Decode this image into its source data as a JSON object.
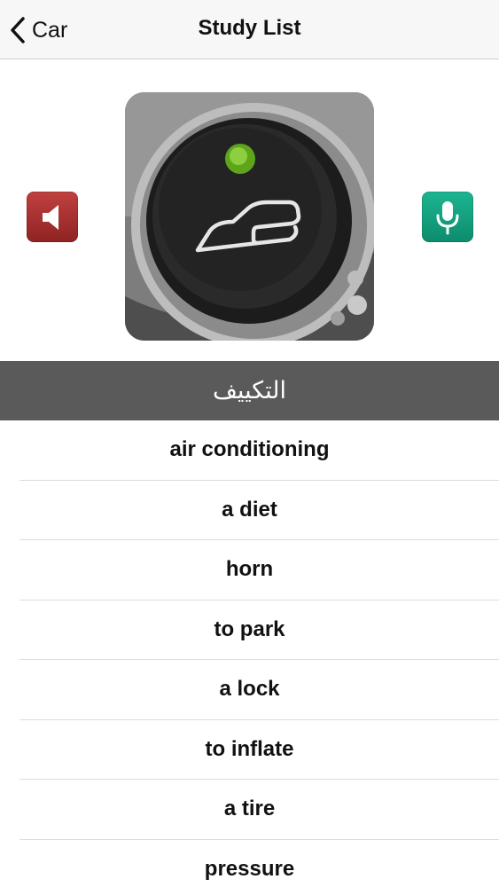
{
  "nav": {
    "back_label": "Car",
    "title": "Study List"
  },
  "card": {
    "term": "التكييف",
    "image_icon": "car-air-recirculation-button-photo"
  },
  "buttons": {
    "sound_icon": "speaker-icon",
    "mic_icon": "microphone-icon",
    "sound_color": "#a8302e",
    "mic_color": "#16a07e"
  },
  "list": {
    "items": [
      "air conditioning",
      "a diet",
      "horn",
      "to park",
      "a lock",
      "to inflate",
      "a tire",
      "pressure"
    ]
  }
}
